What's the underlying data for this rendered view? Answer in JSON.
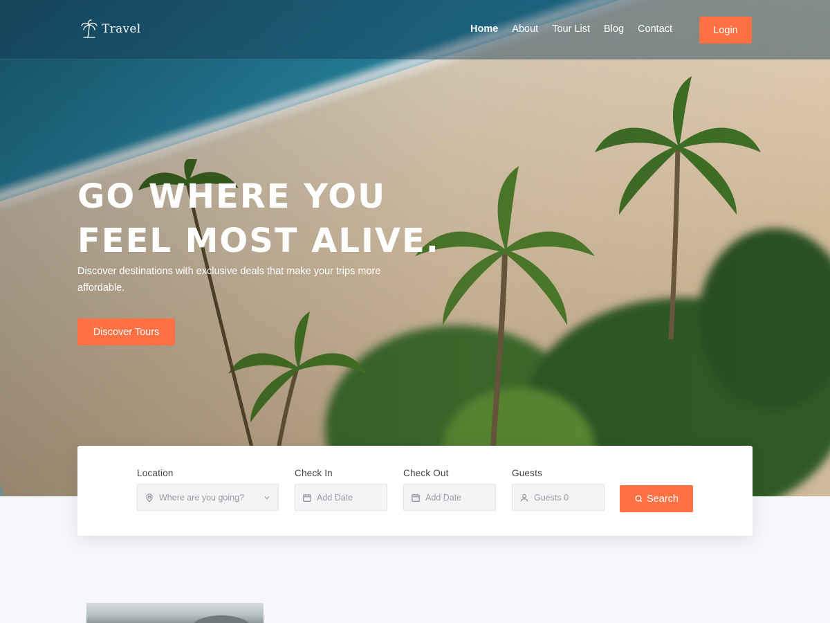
{
  "brand": {
    "name": "Travel",
    "logo_icon": "palm-tree-icon"
  },
  "nav": {
    "items": [
      {
        "label": "Home",
        "active": true
      },
      {
        "label": "About",
        "active": false
      },
      {
        "label": "Tour List",
        "active": false
      },
      {
        "label": "Blog",
        "active": false
      },
      {
        "label": "Contact",
        "active": false
      }
    ],
    "login_label": "Login"
  },
  "hero": {
    "headline_line1": "GO WHERE YOU",
    "headline_line2": "FEEL MOST ALIVE.",
    "subtext": "Discover destinations with exclusive deals that make your trips more affordable.",
    "cta_label": "Discover Tours"
  },
  "search": {
    "location": {
      "label": "Location",
      "placeholder": "Where are you going?",
      "icon": "map-pin-icon"
    },
    "check_in": {
      "label": "Check In",
      "placeholder": "Add Date",
      "icon": "calendar-icon"
    },
    "check_out": {
      "label": "Check Out",
      "placeholder": "Add Date",
      "icon": "calendar-icon"
    },
    "guests": {
      "label": "Guests",
      "placeholder": "Guests 0",
      "icon": "user-icon"
    },
    "button_label": "Search",
    "button_icon": "search-icon"
  },
  "colors": {
    "accent": "#ff7043",
    "page_background": "#f6f7fb",
    "card_background": "#ffffff",
    "input_background": "#f4f4f6",
    "text_light": "#ffffff",
    "label_text": "#444444",
    "placeholder_text": "#9a9aa2"
  }
}
